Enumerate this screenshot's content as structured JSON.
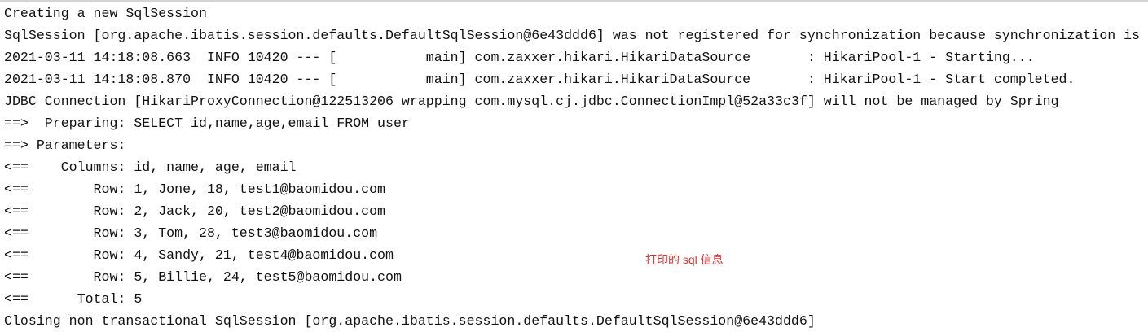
{
  "console": {
    "lines": [
      "Creating a new SqlSession",
      "SqlSession [org.apache.ibatis.session.defaults.DefaultSqlSession@6e43ddd6] was not registered for synchronization because synchronization is",
      "2021-03-11 14:18:08.663  INFO 10420 --- [           main] com.zaxxer.hikari.HikariDataSource       : HikariPool-1 - Starting...",
      "2021-03-11 14:18:08.870  INFO 10420 --- [           main] com.zaxxer.hikari.HikariDataSource       : HikariPool-1 - Start completed.",
      "JDBC Connection [HikariProxyConnection@122513206 wrapping com.mysql.cj.jdbc.ConnectionImpl@52a33c3f] will not be managed by Spring",
      "==>  Preparing: SELECT id,name,age,email FROM user",
      "==> Parameters: ",
      "<==    Columns: id, name, age, email",
      "<==        Row: 1, Jone, 18, test1@baomidou.com",
      "<==        Row: 2, Jack, 20, test2@baomidou.com",
      "<==        Row: 3, Tom, 28, test3@baomidou.com",
      "<==        Row: 4, Sandy, 21, test4@baomidou.com",
      "<==        Row: 5, Billie, 24, test5@baomidou.com",
      "<==      Total: 5",
      "Closing non transactional SqlSession [org.apache.ibatis.session.defaults.DefaultSqlSession@6e43ddd6]"
    ]
  },
  "annotation": {
    "text": "打印的 sql 信息",
    "color": "#e3302f"
  }
}
